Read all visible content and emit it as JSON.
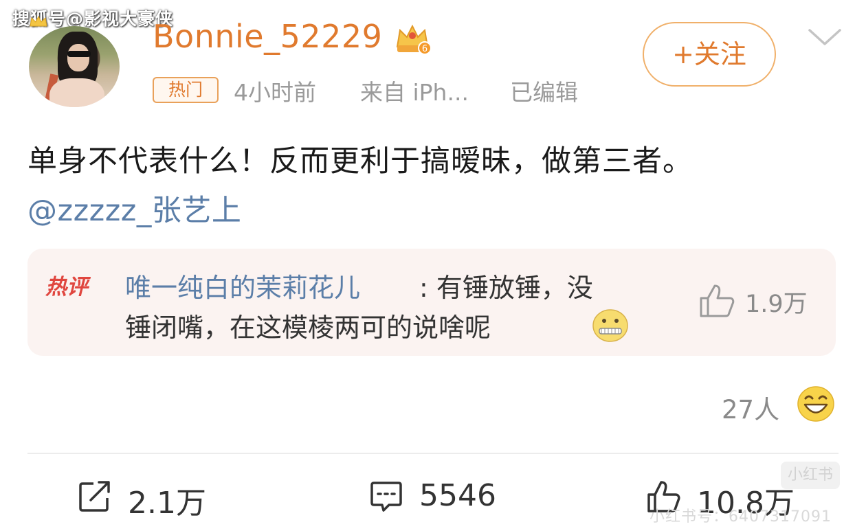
{
  "watermark_top": "搜狐号@影视大豪侠",
  "post": {
    "username": "Bonnie_52229",
    "vip_level": "6",
    "hot_tag": "热门",
    "time": "4小时前",
    "source": "来自 iPh...",
    "edited": "已编辑",
    "follow_label": "+关注",
    "text": "单身不代表什么！反而更利于搞暧昧，做第三者。",
    "mention": "@zzzzz_张艺上"
  },
  "hot_comment": {
    "label": "热评",
    "author": "唯一纯白的茉莉花儿",
    "text_line1": ": 有锤放锤，没",
    "text_line2": "锤闭嘴，在这模棱两可的说啥呢",
    "likes": "1.9万"
  },
  "reactions": {
    "count": "27人"
  },
  "actions": {
    "share_count": "2.1万",
    "comment_count": "5546",
    "like_count": "10.8万"
  },
  "watermark_br": {
    "text": "小红书号：6407317091",
    "logo": "小红书"
  },
  "colors": {
    "username": "#e07a2e",
    "link": "#5b7ea8",
    "hot_label": "#e0463f",
    "muted": "#9a9a9a"
  },
  "icons": [
    "crown-icon",
    "vip-crown-icon",
    "chevron-down-icon",
    "zipper-mouth-emoji",
    "thumbs-up-icon",
    "laughing-emoji",
    "share-icon",
    "comment-icon"
  ]
}
